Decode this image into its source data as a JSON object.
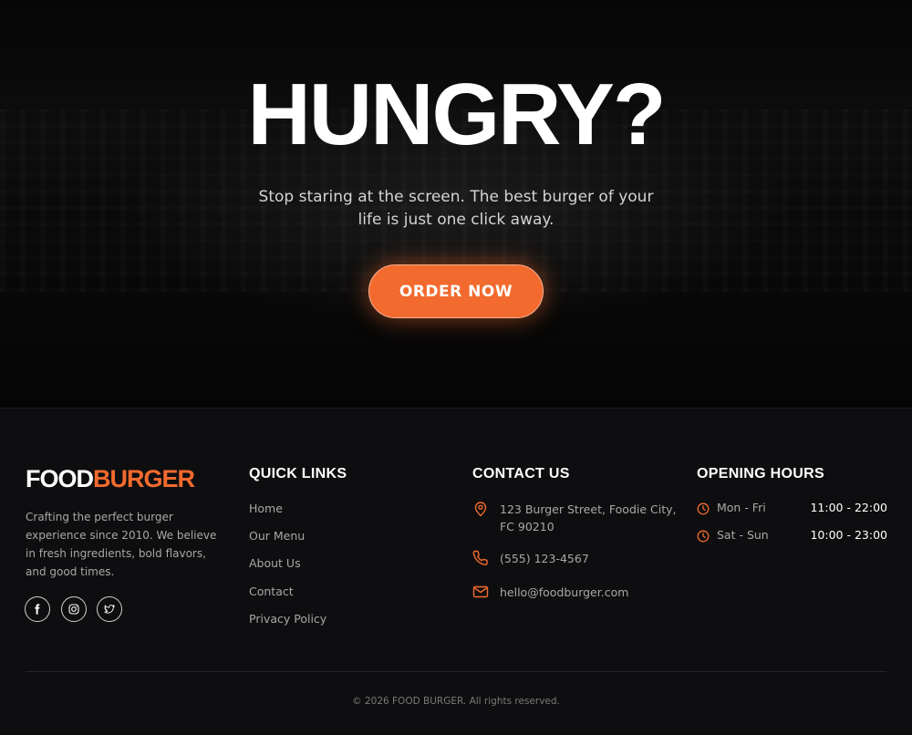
{
  "hero": {
    "title": "HUNGRY?",
    "subtitle": "Stop staring at the screen. The best burger of your life is just one click away.",
    "cta_label": "ORDER NOW"
  },
  "footer": {
    "brand": {
      "part1": "FOOD",
      "part2": "BURGER"
    },
    "about": "Crafting the perfect burger experience since 2010. We believe in fresh ingredients, bold flavors, and good times.",
    "social": [
      {
        "icon": "facebook-icon"
      },
      {
        "icon": "instagram-icon"
      },
      {
        "icon": "twitter-icon"
      }
    ],
    "quick_links": {
      "title": "QUICK LINKS",
      "items": [
        "Home",
        "Our Menu",
        "About Us",
        "Contact",
        "Privacy Policy"
      ]
    },
    "contact": {
      "title": "CONTACT US",
      "address": "123 Burger Street, Foodie City, FC 90210",
      "phone": "(555) 123-4567",
      "email": "hello@foodburger.com"
    },
    "hours": {
      "title": "OPENING HOURS",
      "rows": [
        {
          "day": "Mon - Fri",
          "time": "11:00 - 22:00"
        },
        {
          "day": "Sat - Sun",
          "time": "10:00 - 23:00"
        }
      ]
    },
    "copyright": "© 2026 FOOD BURGER. All rights reserved."
  },
  "colors": {
    "accent": "#f26a2e",
    "background": "#0e0e10",
    "text_muted": "#a8a8a8"
  }
}
